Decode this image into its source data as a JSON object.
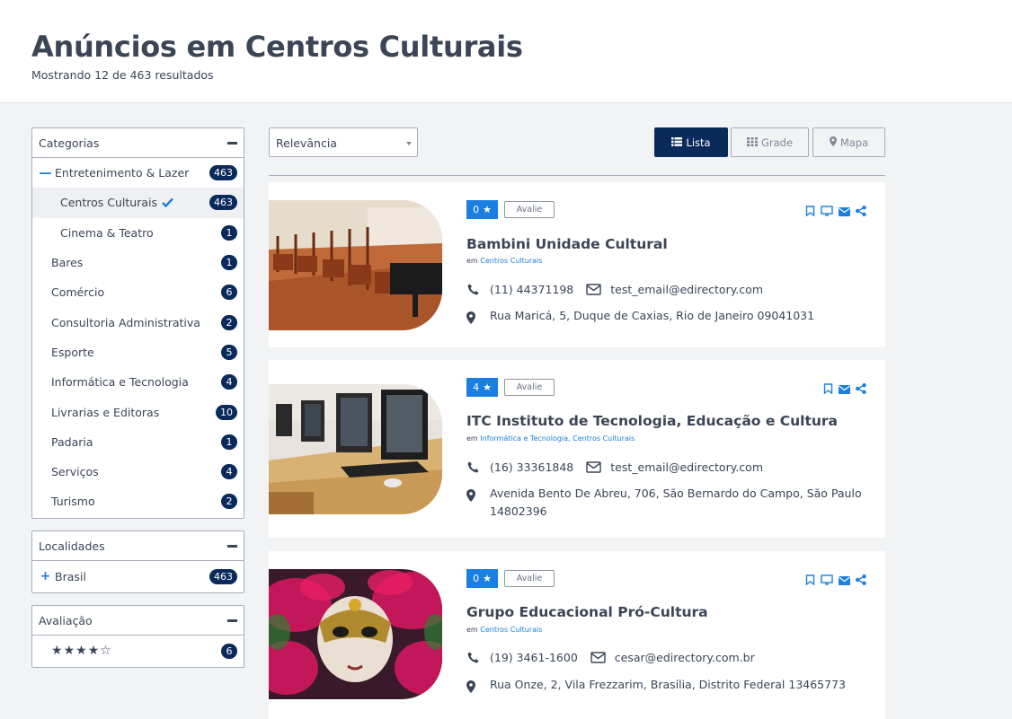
{
  "header": {
    "title": "Anúncios em Centros Culturais",
    "subtitle": "Mostrando 12 de 463 resultados"
  },
  "sidebar": {
    "categories": {
      "title": "Categorias",
      "items": [
        {
          "label": "Entretenimento & Lazer",
          "count": "463",
          "toggle": "minus"
        },
        {
          "label": "Centros Culturais",
          "count": "463",
          "selected": true
        },
        {
          "label": "Cinema & Teatro",
          "count": "1"
        },
        {
          "label": "Bares",
          "count": "1"
        },
        {
          "label": "Comércio",
          "count": "6"
        },
        {
          "label": "Consultoria Administrativa",
          "count": "2"
        },
        {
          "label": "Esporte",
          "count": "5"
        },
        {
          "label": "Informática e Tecnologia",
          "count": "4"
        },
        {
          "label": "Livrarias e Editoras",
          "count": "10"
        },
        {
          "label": "Padaria",
          "count": "1"
        },
        {
          "label": "Serviços",
          "count": "4"
        },
        {
          "label": "Turismo",
          "count": "2"
        }
      ]
    },
    "locations": {
      "title": "Localidades",
      "items": [
        {
          "label": "Brasil",
          "count": "463"
        }
      ]
    },
    "rating": {
      "title": "Avaliação",
      "stars_filled": 4,
      "stars_total": 5,
      "count": "6"
    }
  },
  "toolbar": {
    "sort_value": "Relevância",
    "views": {
      "list": "Lista",
      "grid": "Grade",
      "map": "Mapa"
    },
    "active_view": "list"
  },
  "colors": {
    "accent": "#1a7fe0",
    "navy": "#0a2a5c",
    "text": "#3b4556"
  },
  "listings": [
    {
      "rating": "0",
      "rate_label": "Avalie",
      "title": "Bambini Unidade Cultural",
      "prefix": "em",
      "categories": "Centros Culturais",
      "phone": "(11) 44371198",
      "email": "test_email@edirectory.com",
      "address": "Rua Maricá, 5, Duque de Caxias, Rio de Janeiro 09041031",
      "image": "auditorium-photo",
      "actions": [
        "bookmark-icon",
        "monitor-icon",
        "envelope-icon",
        "share-icon"
      ]
    },
    {
      "rating": "4",
      "rate_label": "Avalie",
      "title": "ITC Instituto de Tecnologia, Educação e Cultura",
      "prefix": "em",
      "categories": "Informática e Tecnologia, Centros Culturais",
      "phone": "(16) 33361848",
      "email": "test_email@edirectory.com",
      "address": "Avenida Bento De Abreu, 706, São Bernardo do Campo, São Paulo 14802396",
      "image": "computer-lab-photo",
      "actions": [
        "bookmark-icon",
        "envelope-icon",
        "share-icon"
      ]
    },
    {
      "rating": "0",
      "rate_label": "Avalie",
      "title": "Grupo Educacional Pró-Cultura",
      "prefix": "em",
      "categories": "Centros Culturais",
      "phone": "(19) 3461-1600",
      "email": "cesar@edirectory.com.br",
      "address": "Rua Onze, 2, Vila Frezzarim, Brasília, Distrito Federal 13465773",
      "image": "carnival-mask-photo",
      "actions": [
        "bookmark-icon",
        "monitor-icon",
        "envelope-icon",
        "share-icon"
      ]
    }
  ]
}
